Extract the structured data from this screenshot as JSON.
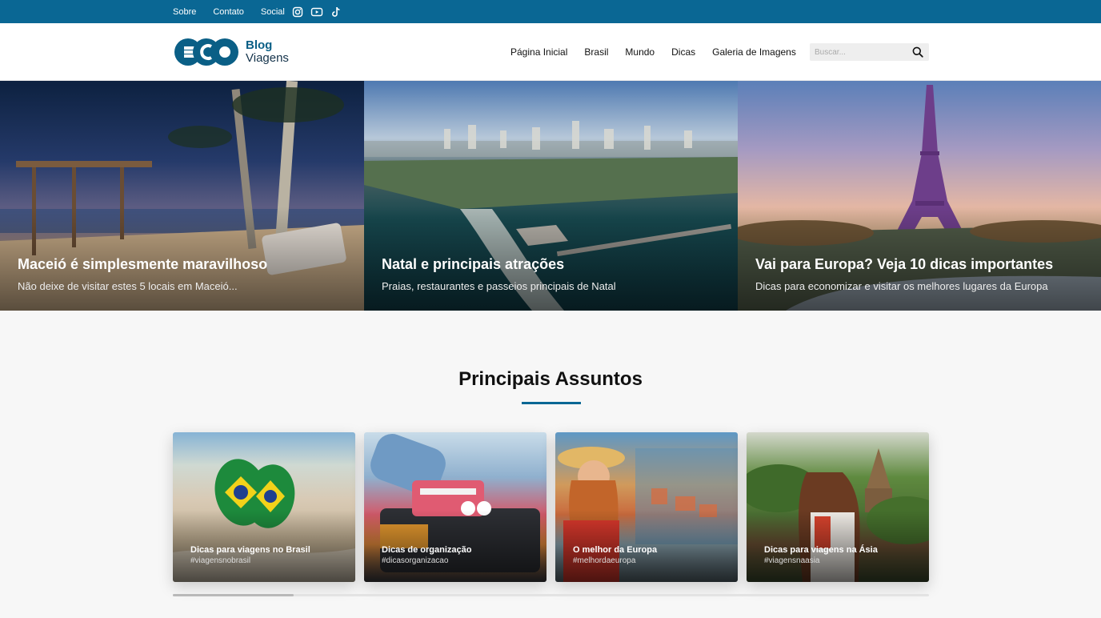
{
  "topbar": {
    "links": [
      "Sobre",
      "Contato"
    ],
    "social_label": "Social",
    "social_icons": [
      "instagram-icon",
      "youtube-icon",
      "tiktok-icon"
    ],
    "bg_color": "#0a6794"
  },
  "header": {
    "logo": {
      "mark": "ECO",
      "line1": "Blog",
      "line2": "Viagens"
    },
    "nav": [
      "Página Inicial",
      "Brasil",
      "Mundo",
      "Dicas",
      "Galeria de Imagens"
    ],
    "search_placeholder": "Buscar..."
  },
  "hero": [
    {
      "title": "Maceió é simplesmente maravilhoso",
      "subtitle": "Não deixe de visitar estes 5 locais em Maceió..."
    },
    {
      "title": "Natal e principais atrações",
      "subtitle": "Praias, restaurantes e passeios principais de Natal"
    },
    {
      "title": "Vai para Europa? Veja 10 dicas importantes",
      "subtitle": "Dicas para economizar e visitar os melhores lugares da Europa"
    }
  ],
  "section": {
    "title": "Principais Assuntos",
    "accent_color": "#0a6794"
  },
  "topics": [
    {
      "title": "Dicas para viagens no Brasil",
      "tag": "#viagensnobrasil"
    },
    {
      "title": "Dicas de organização",
      "tag": "#dicasorganizacao"
    },
    {
      "title": "O melhor da Europa",
      "tag": "#melhordaeuropa"
    },
    {
      "title": "Dicas para viagens na Ásia",
      "tag": "#viagensnaasia"
    }
  ],
  "carousel": {
    "progress": 0.16
  }
}
